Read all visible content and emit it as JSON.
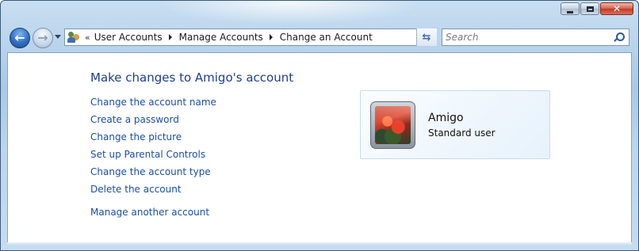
{
  "window": {
    "caption": {
      "minimize": "minimize-icon",
      "maximize": "maximize-icon",
      "close_glyph": "✕"
    }
  },
  "nav": {
    "back_glyph": "←",
    "forward_glyph": "→"
  },
  "address": {
    "overflow": "«",
    "crumbs": [
      "User Accounts",
      "Manage Accounts",
      "Change an Account"
    ]
  },
  "search": {
    "placeholder": "Search"
  },
  "main": {
    "title": "Make changes to Amigo's account",
    "links": [
      "Change the account name",
      "Create a password",
      "Change the picture",
      "Set up Parental Controls",
      "Change the account type",
      "Delete the account"
    ],
    "other_link": "Manage another account"
  },
  "account": {
    "name": "Amigo",
    "type": "Standard user"
  },
  "colors": {
    "link": "#1a4ea8",
    "title": "#1b3f91",
    "close": "#c0392b"
  }
}
